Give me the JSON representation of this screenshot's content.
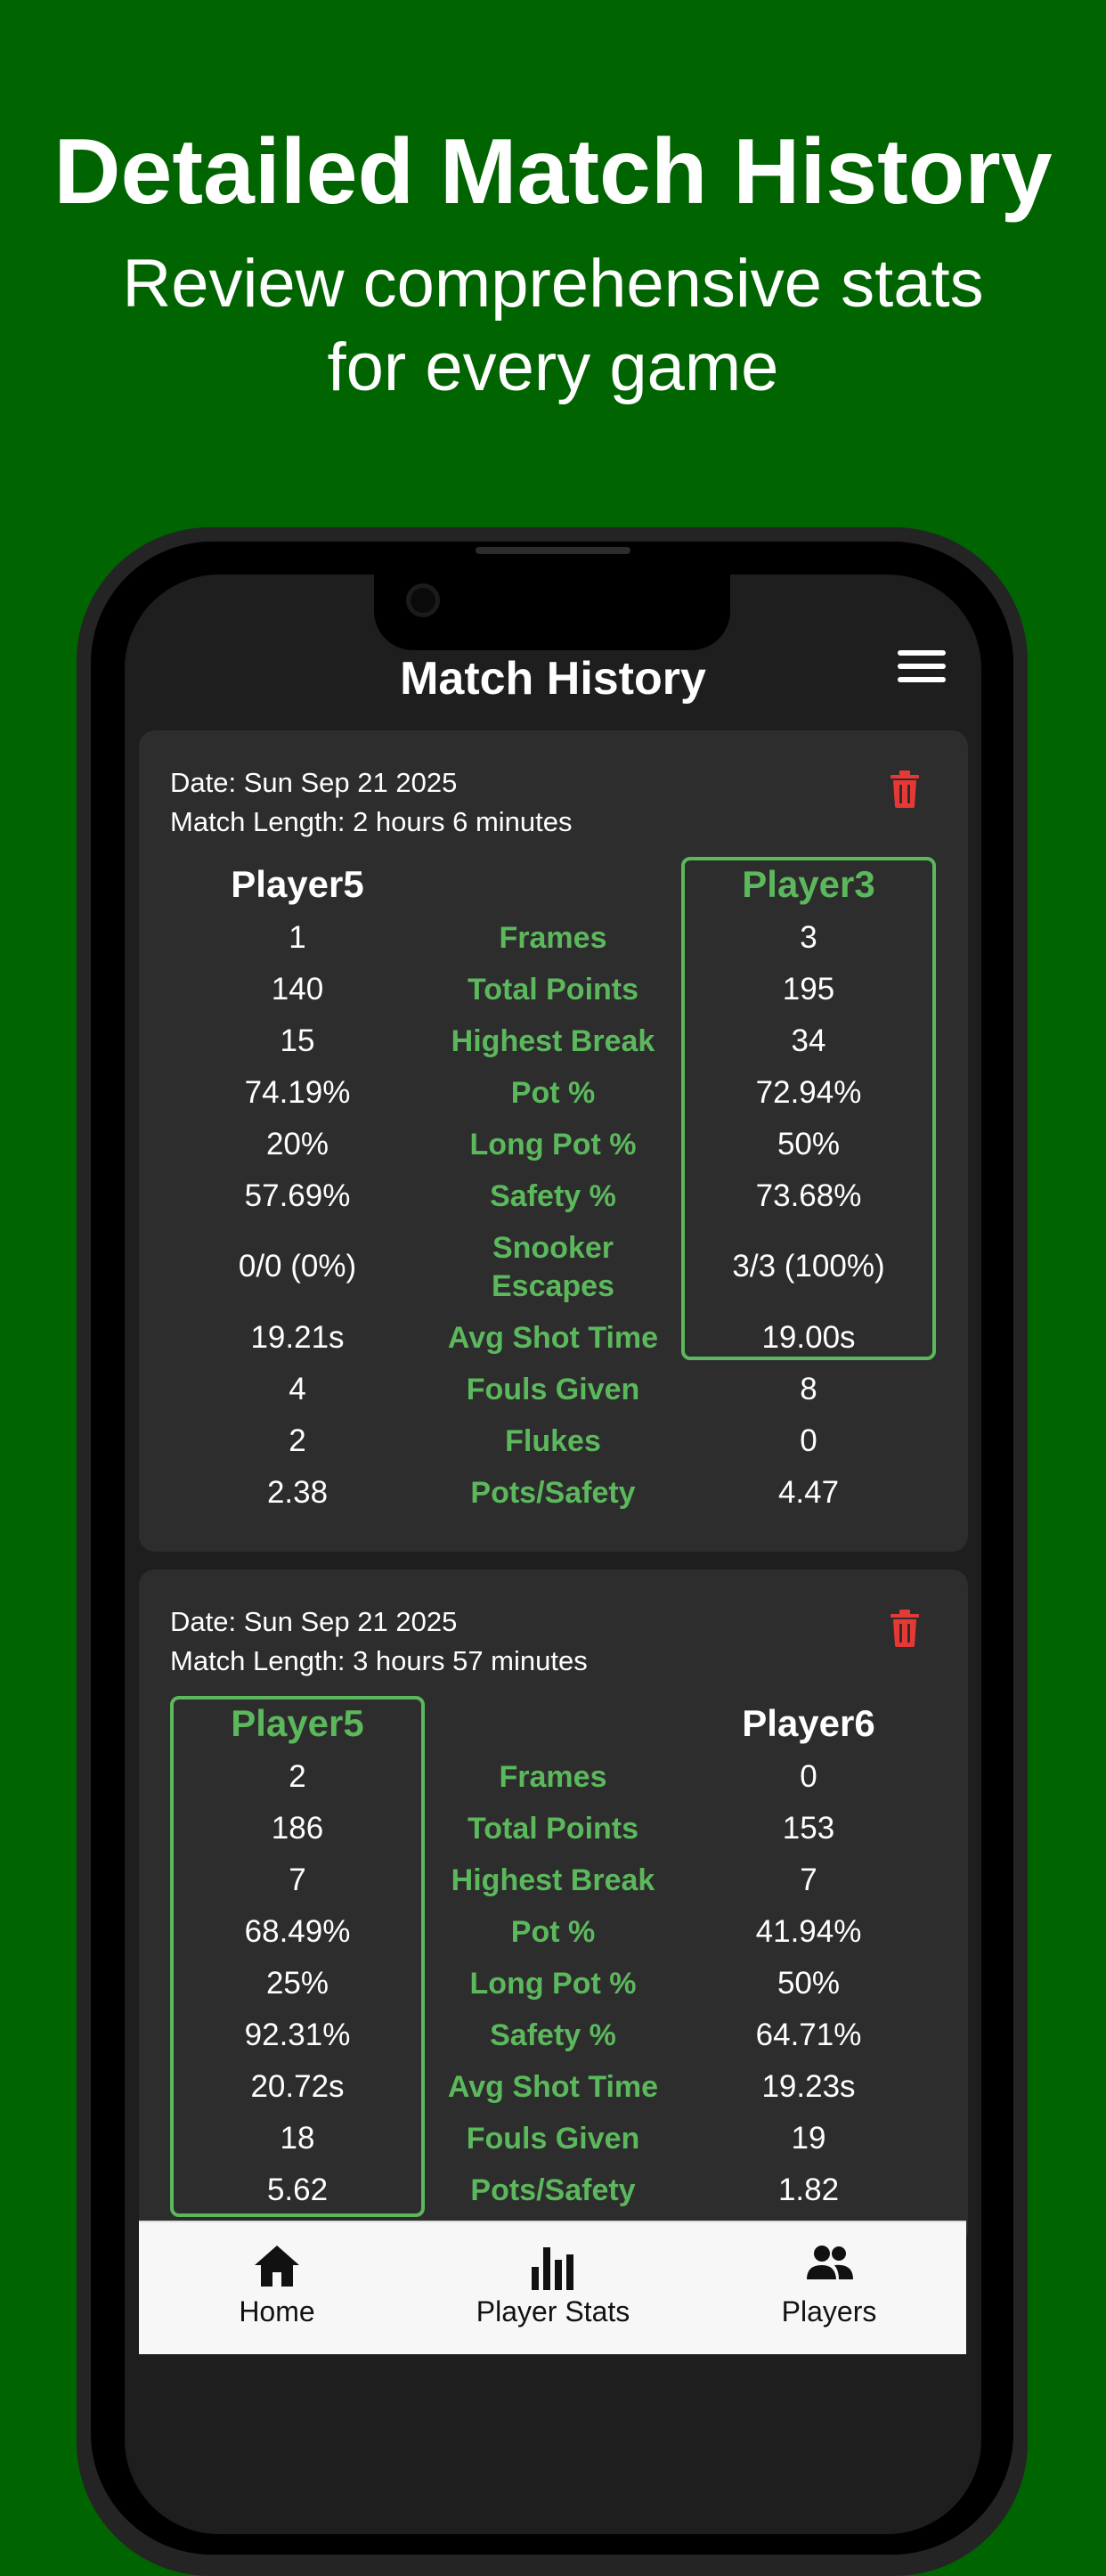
{
  "promo": {
    "title": "Detailed Match History",
    "subtitle_line1": "Review comprehensive stats",
    "subtitle_line2": "for every game"
  },
  "header": {
    "title": "Match History"
  },
  "colors": {
    "accent": "#5cb85c",
    "background": "#006400",
    "card": "#2d2d2d",
    "delete": "#e53935"
  },
  "stat_labels": [
    "Frames",
    "Total Points",
    "Highest Break",
    "Pot %",
    "Long Pot %",
    "Safety %",
    "Snooker Escapes",
    "Avg Shot Time",
    "Fouls Given",
    "Flukes",
    "Pots/Safety"
  ],
  "matches": [
    {
      "date": "Date: Sun Sep 21 2025",
      "length": "Match Length: 2 hours 6 minutes",
      "player1": {
        "name": "Player5",
        "frames": "1",
        "total_points": "140",
        "highest_break": "15",
        "pot_pct": "74.19%",
        "long_pot_pct": "20%",
        "safety_pct": "57.69%",
        "snooker_escapes": "0/0 (0%)",
        "avg_shot_time": "19.21s",
        "fouls_given": "4",
        "flukes": "2",
        "pots_safety": "2.38"
      },
      "player2": {
        "name": "Player3",
        "frames": "3",
        "total_points": "195",
        "highest_break": "34",
        "pot_pct": "72.94%",
        "long_pot_pct": "50%",
        "safety_pct": "73.68%",
        "snooker_escapes": "3/3 (100%)",
        "avg_shot_time": "19.00s",
        "fouls_given": "8",
        "flukes": "0",
        "pots_safety": "4.47"
      },
      "labels": {
        "frames": "Frames",
        "total_points": "Total Points",
        "highest_break": "Highest Break",
        "pot_pct": "Pot %",
        "long_pot_pct": "Long Pot %",
        "safety_pct": "Safety %",
        "snooker_escapes_1": "Snooker",
        "snooker_escapes_2": "Escapes",
        "avg_shot_time": "Avg Shot Time",
        "fouls_given": "Fouls Given",
        "flukes": "Flukes",
        "pots_safety": "Pots/Safety"
      }
    },
    {
      "date": "Date: Sun Sep 21 2025",
      "length": "Match Length: 3 hours 57 minutes",
      "player1": {
        "name": "Player5",
        "frames": "2",
        "total_points": "186",
        "highest_break": "7",
        "pot_pct": "68.49%",
        "long_pot_pct": "25%",
        "safety_pct": "92.31%",
        "avg_shot_time": "20.72s",
        "fouls_given": "18",
        "pots_safety": "5.62"
      },
      "player2": {
        "name": "Player6",
        "frames": "0",
        "total_points": "153",
        "highest_break": "7",
        "pot_pct": "41.94%",
        "long_pot_pct": "50%",
        "safety_pct": "64.71%",
        "avg_shot_time": "19.23s",
        "fouls_given": "19",
        "pots_safety": "1.82"
      },
      "labels": {
        "frames": "Frames",
        "total_points": "Total Points",
        "highest_break": "Highest Break",
        "pot_pct": "Pot %",
        "long_pot_pct": "Long Pot %",
        "safety_pct": "Safety %",
        "avg_shot_time": "Avg Shot Time",
        "fouls_given": "Fouls Given",
        "pots_safety": "Pots/Safety"
      }
    }
  ],
  "nav": {
    "home": "Home",
    "player_stats": "Player Stats",
    "players": "Players"
  }
}
